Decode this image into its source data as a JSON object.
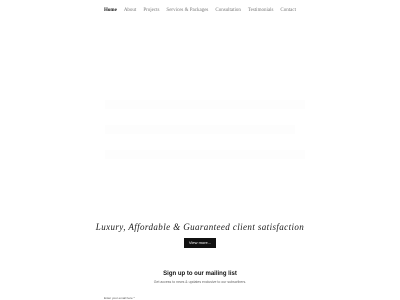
{
  "nav": {
    "items": [
      {
        "label": "Home",
        "active": true
      },
      {
        "label": "About",
        "active": false
      },
      {
        "label": "Projects",
        "active": false
      },
      {
        "label": "Services & Packages",
        "active": false
      },
      {
        "label": "Consultation",
        "active": false
      },
      {
        "label": "Testimonials",
        "active": false
      },
      {
        "label": "Contact",
        "active": false
      }
    ]
  },
  "hero": {
    "tagline": "Luxury, Affordable & Guaranteed client satisfaction",
    "cta_label": "View more..."
  },
  "mailing": {
    "title": "Sign up to our mailing list",
    "subtitle": "Get access to news & updates exclusive to our subscribers.",
    "email_label": "Enter your email here *"
  }
}
